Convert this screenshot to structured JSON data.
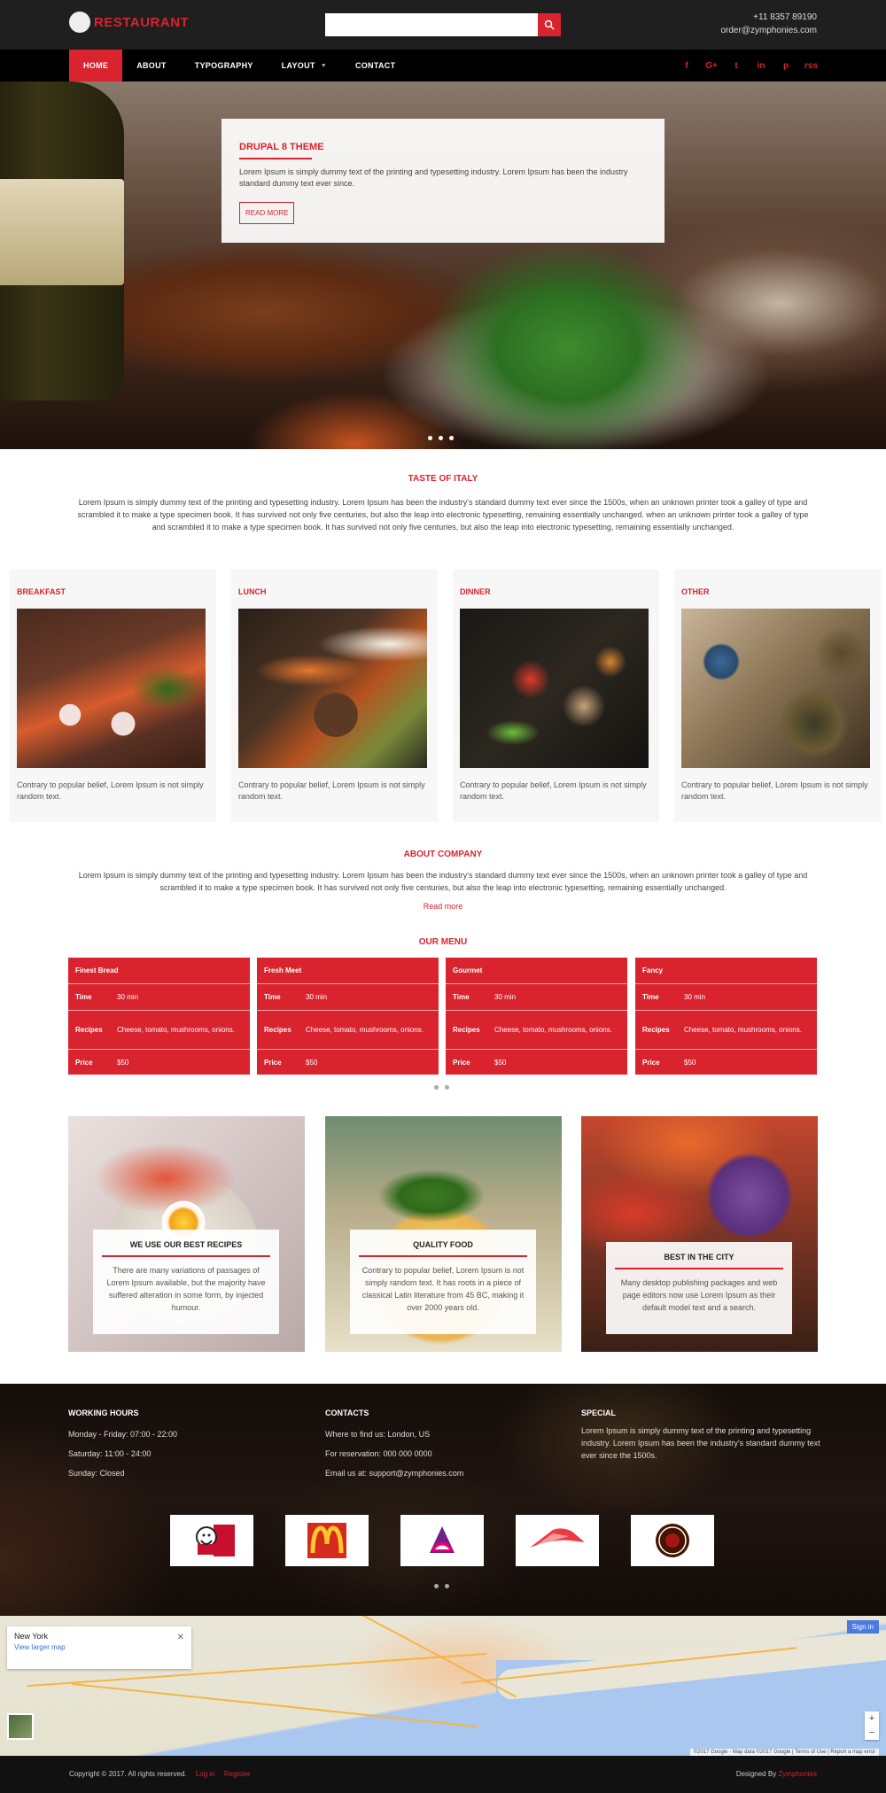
{
  "header": {
    "brand": "RESTAURANT",
    "phone": "+11 8357 89190",
    "email": "order@zymphonies.com",
    "search_placeholder": ""
  },
  "nav": {
    "items": [
      "HOME",
      "ABOUT",
      "TYPOGRAPHY",
      "LAYOUT",
      "CONTACT"
    ],
    "active": "HOME"
  },
  "social": {
    "icons": [
      "facebook-icon",
      "google-plus-icon",
      "twitter-icon",
      "linkedin-icon",
      "pinterest-icon",
      "rss-icon"
    ],
    "glyphs": [
      "f",
      "G+",
      "t",
      "in",
      "p",
      "rss"
    ]
  },
  "hero": {
    "title": "DRUPAL 8 THEME",
    "text": "Lorem Ipsum is simply dummy text of the printing and typesetting industry. Lorem Ipsum has been the industry standard dummy text ever since.",
    "button": "READ MORE"
  },
  "taste": {
    "title": "TASTE OF ITALY",
    "text": "Lorem Ipsum is simply dummy text of the printing and typesetting industry. Lorem Ipsum has been the industry's standard dummy text ever since the 1500s, when an unknown printer took a galley of type and scrambled it to make a type specimen book. It has survived not only five centuries, but also the leap into electronic typesetting, remaining essentially unchanged. when an unknown printer took a galley of type and scrambled it to make a type specimen book. It has survived not only five centuries, but also the leap into electronic typesetting, remaining essentially unchanged."
  },
  "meals": [
    {
      "title": "BREAKFAST",
      "text": "Contrary to popular belief, Lorem Ipsum is not simply random text."
    },
    {
      "title": "LUNCH",
      "text": "Contrary to popular belief, Lorem Ipsum is not simply random text."
    },
    {
      "title": "DINNER",
      "text": "Contrary to popular belief, Lorem Ipsum is not simply random text."
    },
    {
      "title": "OTHER",
      "text": "Contrary to popular belief, Lorem Ipsum is not simply random text."
    }
  ],
  "about": {
    "title": "ABOUT COMPANY",
    "text": "Lorem Ipsum is simply dummy text of the printing and typesetting industry. Lorem Ipsum has been the industry's standard dummy text ever since the 1500s, when an unknown printer took a galley of type and scrambled it to make a type specimen book. It has survived not only five centuries, but also the leap into electronic typesetting, remaining essentially unchanged.",
    "link": "Read more"
  },
  "menu": {
    "title": "OUR MENU",
    "labels": {
      "time": "Time",
      "recipes": "Recipes",
      "price": "Price"
    },
    "items": [
      {
        "name": "Finest Bread",
        "time": "30 min",
        "recipes": "Cheese, tomato, mushrooms, onions.",
        "price": "$50"
      },
      {
        "name": "Fresh Meet",
        "time": "30 min",
        "recipes": "Cheese, tomato, mushrooms, onions.",
        "price": "$50"
      },
      {
        "name": "Gourmet",
        "time": "30 min",
        "recipes": "Cheese, tomato, mushrooms, onions.",
        "price": "$50"
      },
      {
        "name": "Fancy",
        "time": "30 min",
        "recipes": "Cheese, tomato, mushrooms, onions.",
        "price": "$50"
      }
    ]
  },
  "features": [
    {
      "title": "WE USE OUR BEST RECIPES",
      "text": "There are many variations of passages of Lorem Ipsum available, but the majority have suffered alteration in some form, by injected humour."
    },
    {
      "title": "QUALITY FOOD",
      "text": "Contrary to popular belief, Lorem Ipsum is not simply random text. It has roots in a piece of classical Latin literature from 45 BC, making it over 2000 years old."
    },
    {
      "title": "BEST IN THE CITY",
      "text": "Many desktop publishing packages and web page editors now use Lorem Ipsum as their default model text and a search."
    }
  ],
  "footer": {
    "hours": {
      "title": "WORKING HOURS",
      "lines": [
        "Monday - Friday: 07:00 - 22:00",
        "Saturday: 11:00 - 24:00",
        "Sunday: Closed"
      ]
    },
    "contacts": {
      "title": "CONTACTS",
      "lines": [
        "Where to find us: London, US",
        "For reservation: 000 000 0000",
        "Email us at: support@zymphonies.com"
      ]
    },
    "special": {
      "title": "SPECIAL",
      "text": "Lorem Ipsum is simply dummy text of the printing and typesetting industry. Lorem Ipsum has been the industry's standard dummy text ever since the 1500s."
    },
    "partner_logos": [
      "kfc-logo",
      "mcdonalds-logo",
      "taco-bell-logo",
      "pizza-hut-logo",
      "chipotle-logo"
    ]
  },
  "map": {
    "place": "New York",
    "link": "View larger map",
    "signin": "Sign in",
    "credit": "©2017 Google - Map data ©2017 Google | Terms of Use | Report a map error",
    "zoom_in": "+",
    "zoom_out": "−"
  },
  "bottom": {
    "copyright": "Copyright © 2017. All rights reserved.",
    "login": "Log in",
    "register": "Register",
    "designed_prefix": "Designed By",
    "designer": "Zymphonies"
  },
  "colors": {
    "accent": "#d9232e",
    "dark": "#1f1f1f",
    "nav": "#000000"
  }
}
